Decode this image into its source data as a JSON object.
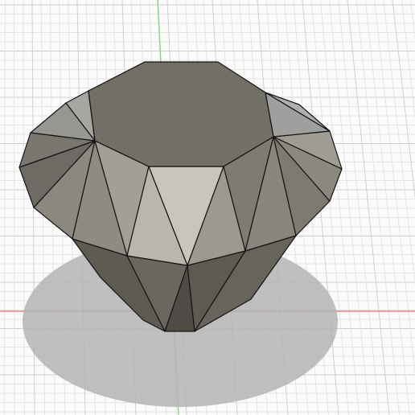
{
  "viewport": {
    "background": "#fbfbfb",
    "grid_minor_color": "#e4e4e4",
    "grid_major_color": "#cfcfcf",
    "x_axis_color": "#e06a6a",
    "y_axis_color": "#7fd67f",
    "shadow_color": "#b4b4b4"
  },
  "model": {
    "name": "",
    "base_color": "#7b786f",
    "outline_color": "#141414",
    "shape": "faceted gem (octagonal table, crown and pavilion facets)"
  }
}
